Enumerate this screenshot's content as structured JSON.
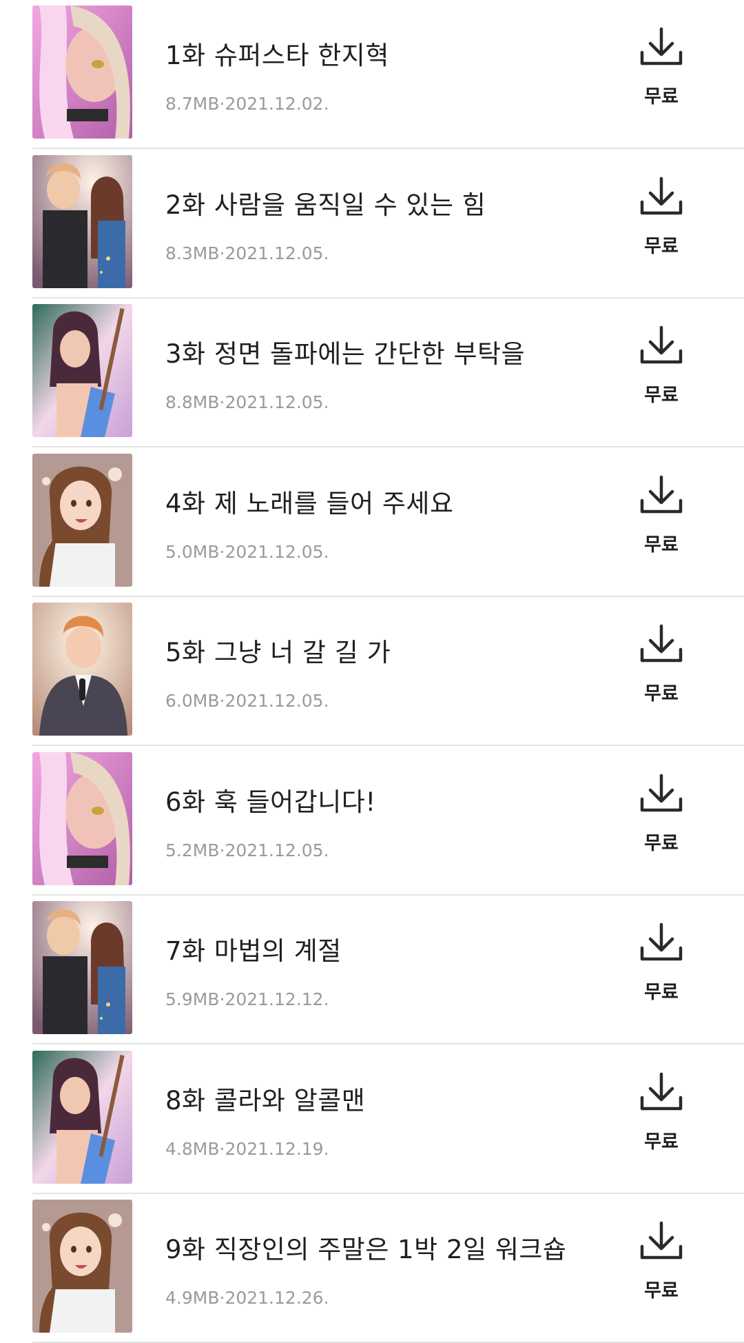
{
  "episodes": [
    {
      "title": "1화 슈퍼스타 한지혁",
      "size": "8.7MB",
      "date": "2021.12.02.",
      "cost": "무료",
      "thumb": "pink-hair-girl"
    },
    {
      "title": "2화 사람을 움직일 수 있는 힘",
      "size": "8.3MB",
      "date": "2021.12.05.",
      "cost": "무료",
      "thumb": "duo-stage"
    },
    {
      "title": "3화 정면 돌파에는 간단한 부탁을",
      "size": "8.8MB",
      "date": "2021.12.05.",
      "cost": "무료",
      "thumb": "bass-girl"
    },
    {
      "title": "4화 제 노래를 들어 주세요",
      "size": "5.0MB",
      "date": "2021.12.05.",
      "cost": "무료",
      "thumb": "brown-hair-girl"
    },
    {
      "title": "5화 그냥 너 갈 길 가",
      "size": "6.0MB",
      "date": "2021.12.05.",
      "cost": "무료",
      "thumb": "mic-boy"
    },
    {
      "title": "6화 훅 들어갑니다!",
      "size": "5.2MB",
      "date": "2021.12.05.",
      "cost": "무료",
      "thumb": "pink-hair-girl"
    },
    {
      "title": "7화 마법의 계절",
      "size": "5.9MB",
      "date": "2021.12.12.",
      "cost": "무료",
      "thumb": "duo-stage"
    },
    {
      "title": "8화 콜라와 알콜맨",
      "size": "4.8MB",
      "date": "2021.12.19.",
      "cost": "무료",
      "thumb": "bass-girl"
    },
    {
      "title": "9화 직장인의 주말은 1박 2일 워크숍",
      "size": "4.9MB",
      "date": "2021.12.26.",
      "cost": "무료",
      "thumb": "brown-hair-girl"
    }
  ],
  "meta_separator": "·",
  "colors": {
    "title": "#1f1f1f",
    "meta": "#9a9a9a",
    "divider": "#e4e4e4",
    "icon": "#2a2a2a"
  }
}
